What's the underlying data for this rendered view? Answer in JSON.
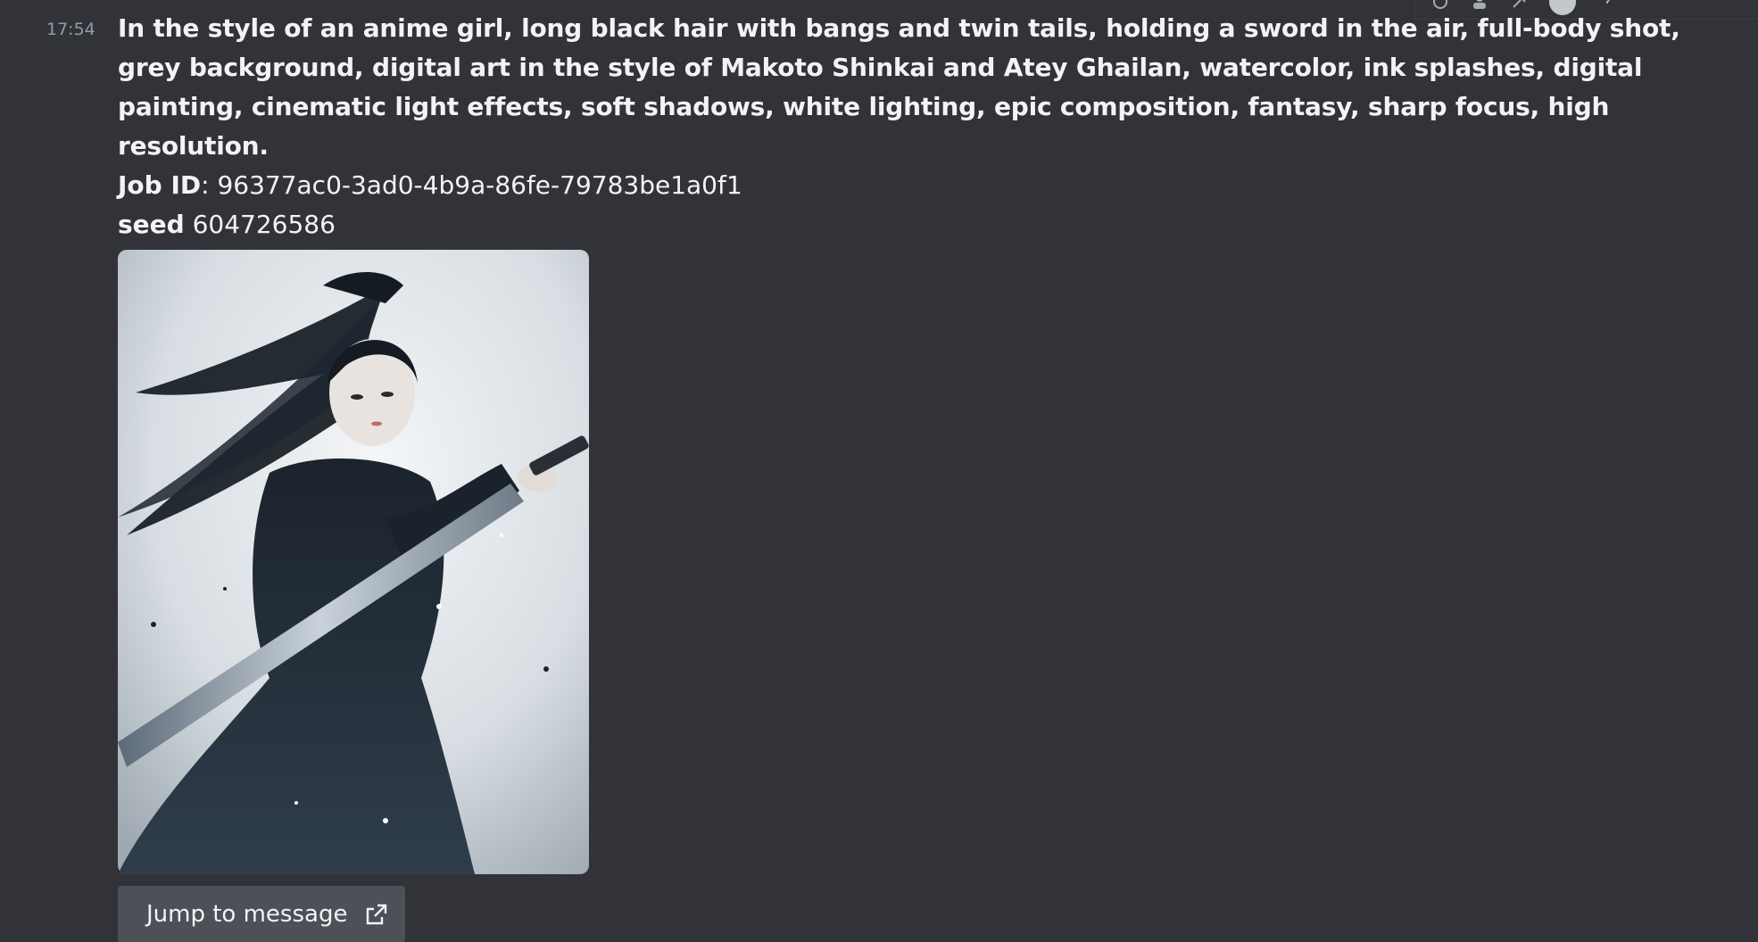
{
  "message": {
    "timestamp": "17:54",
    "prompt": "In the style of an anime girl, long black hair with bangs and twin tails, holding a sword in the air, full-body shot, grey background, digital art in the style of Makoto Shinkai and Atey Ghailan, watercolor, ink splashes, digital painting, cinematic light effects, soft shadows, white lighting, epic composition, fantasy, sharp focus, high resolution.",
    "job_id_label": "Job ID",
    "job_id_separator": ": ",
    "job_id_value": "96377ac0-3ad0-4b9a-86fe-79783be1a0f1",
    "seed_label": "seed",
    "seed_value": "604726586"
  },
  "attachment": {
    "icon": "generated-image"
  },
  "actions": {
    "jump_label": "Jump to message",
    "jump_icon": "external-link-icon"
  },
  "toolbar": {
    "icons": [
      "thread-icon",
      "members-icon",
      "pin-icon",
      "avatar",
      "help-icon"
    ]
  },
  "colors": {
    "background": "#313338",
    "text": "#f2f3f5",
    "muted": "#949ba4",
    "button": "#4e5058"
  }
}
